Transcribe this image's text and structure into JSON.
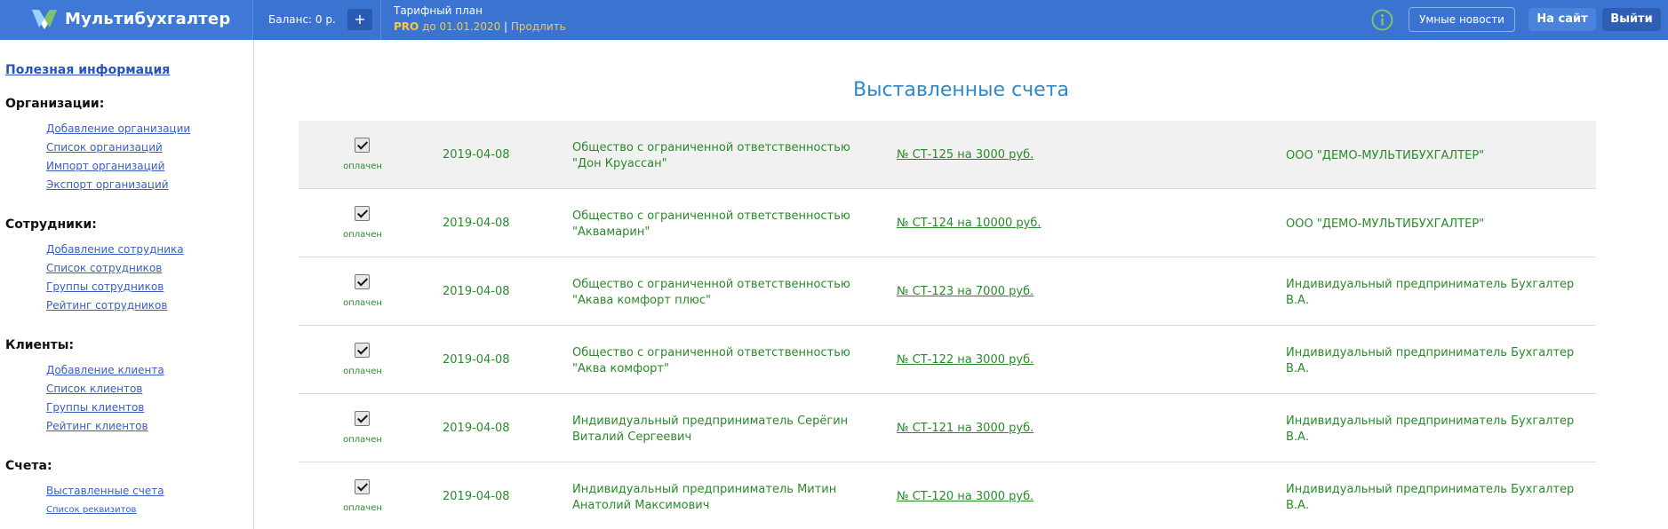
{
  "header": {
    "brand": "Мультибухгалтер",
    "balance_label": "Баланс: 0 р.",
    "balance_add": "+",
    "tariff_title": "Тарифный план",
    "tariff_plan": "PRO",
    "tariff_until": " до 01.01.2020",
    "tariff_sep": " | ",
    "tariff_extend": "Продлить",
    "news_button": "Умные новости",
    "site_button": "На сайт",
    "exit_button": "Выйти",
    "colors": {
      "bar": "#3b73d1",
      "accent": "#f5c842",
      "info_icon": "#7ec36a"
    }
  },
  "sidebar": {
    "useful_info": "Полезная информация",
    "sections": [
      {
        "title": "Организации:",
        "links": [
          "Добавление организации",
          "Список организаций",
          "Импорт организаций",
          "Экспорт организаций"
        ]
      },
      {
        "title": "Сотрудники:",
        "links": [
          "Добавление сотрудника",
          "Список сотрудников",
          "Группы сотрудников",
          "Рейтинг сотрудников"
        ]
      },
      {
        "title": "Клиенты:",
        "links": [
          "Добавление клиента",
          "Список клиентов",
          "Группы клиентов",
          "Рейтинг клиентов"
        ]
      },
      {
        "title": "Счета:",
        "links": [
          "Выставленные счета",
          "Список реквизитов"
        ]
      }
    ]
  },
  "main": {
    "title": "Выставленные счета",
    "invoices": [
      {
        "status": "оплачен",
        "date": "2019-04-08",
        "client_line1": "Общество с ограниченной ответственностью",
        "client_line2": "\"Дон Круассан\"",
        "invoice": "№ СТ-125 на 3000 руб.",
        "issuer_line1": "ООО \"ДЕМО-МУЛЬТИБУХГАЛТЕР\"",
        "issuer_line2": ""
      },
      {
        "status": "оплачен",
        "date": "2019-04-08",
        "client_line1": "Общество с ограниченной ответственностью",
        "client_line2": "\"Аквамарин\"",
        "invoice": "№ СТ-124 на 10000 руб.",
        "issuer_line1": "ООО \"ДЕМО-МУЛЬТИБУХГАЛТЕР\"",
        "issuer_line2": ""
      },
      {
        "status": "оплачен",
        "date": "2019-04-08",
        "client_line1": "Общество с ограниченной ответственностью",
        "client_line2": "\"Акава комфорт плюс\"",
        "invoice": "№ СТ-123 на 7000 руб.",
        "issuer_line1": "Индивидуальный предприниматель Бухгалтер",
        "issuer_line2": "В.А."
      },
      {
        "status": "оплачен",
        "date": "2019-04-08",
        "client_line1": "Общество с ограниченной ответственностью",
        "client_line2": "\"Аква комфорт\"",
        "invoice": "№ СТ-122 на 3000 руб.",
        "issuer_line1": "Индивидуальный предприниматель Бухгалтер",
        "issuer_line2": "В.А."
      },
      {
        "status": "оплачен",
        "date": "2019-04-08",
        "client_line1": "Индивидуальный предприниматель Серёгин",
        "client_line2": "Виталий Сергеевич",
        "invoice": "№ СТ-121 на 3000 руб.",
        "issuer_line1": "Индивидуальный предприниматель Бухгалтер",
        "issuer_line2": "В.А."
      },
      {
        "status": "оплачен",
        "date": "2019-04-08",
        "client_line1": "Индивидуальный предприниматель Митин",
        "client_line2": "Анатолий Максимович",
        "invoice": "№ СТ-120 на 3000 руб.",
        "issuer_line1": "Индивидуальный предприниматель Бухгалтер",
        "issuer_line2": "В.А."
      }
    ]
  }
}
